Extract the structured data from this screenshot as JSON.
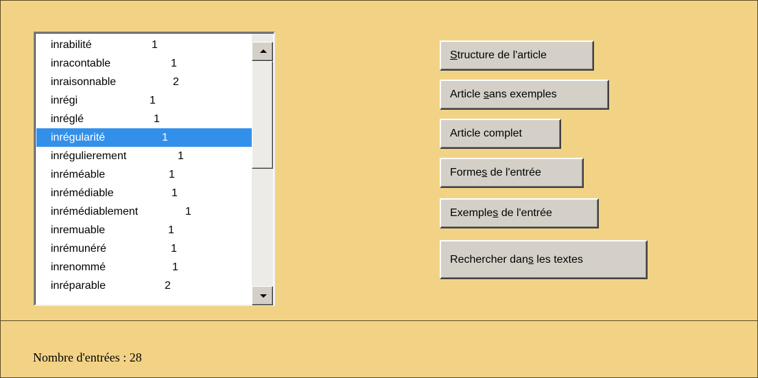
{
  "list": {
    "items": [
      {
        "word": "inrabilité",
        "count": "1"
      },
      {
        "word": "inracontable",
        "count": "1"
      },
      {
        "word": "inraisonnable",
        "count": "2"
      },
      {
        "word": "inrégi",
        "count": "1"
      },
      {
        "word": "inréglé",
        "count": "1"
      },
      {
        "word": "inrégularité",
        "count": "1"
      },
      {
        "word": "inrégulierement",
        "count": "1"
      },
      {
        "word": "inréméable",
        "count": "1"
      },
      {
        "word": "inrémédiable",
        "count": "1"
      },
      {
        "word": "inrémédiablement",
        "count": "1"
      },
      {
        "word": "inremuable",
        "count": "1"
      },
      {
        "word": "inrémunéré",
        "count": "1"
      },
      {
        "word": "inrenommé",
        "count": "1"
      },
      {
        "word": "inréparable",
        "count": "2"
      }
    ],
    "selected_index": 5
  },
  "buttons": [
    {
      "pre": "",
      "accel": "S",
      "post": "tructure de l'article"
    },
    {
      "pre": "Article ",
      "accel": "s",
      "post": "ans exemples"
    },
    {
      "pre": "Article complet",
      "accel": "",
      "post": ""
    },
    {
      "pre": "Forme",
      "accel": "s",
      "post": " de l'entrée"
    },
    {
      "pre": "Exemple",
      "accel": "s",
      "post": " de l'entrée"
    },
    {
      "pre": "Rechercher dan",
      "accel": "s",
      "post": " les textes"
    }
  ],
  "status": {
    "label": "Nombre d'entrées : 28"
  },
  "colors": {
    "background": "#f2d386",
    "selection": "#3390ea",
    "button_face": "#d4d0c8"
  }
}
